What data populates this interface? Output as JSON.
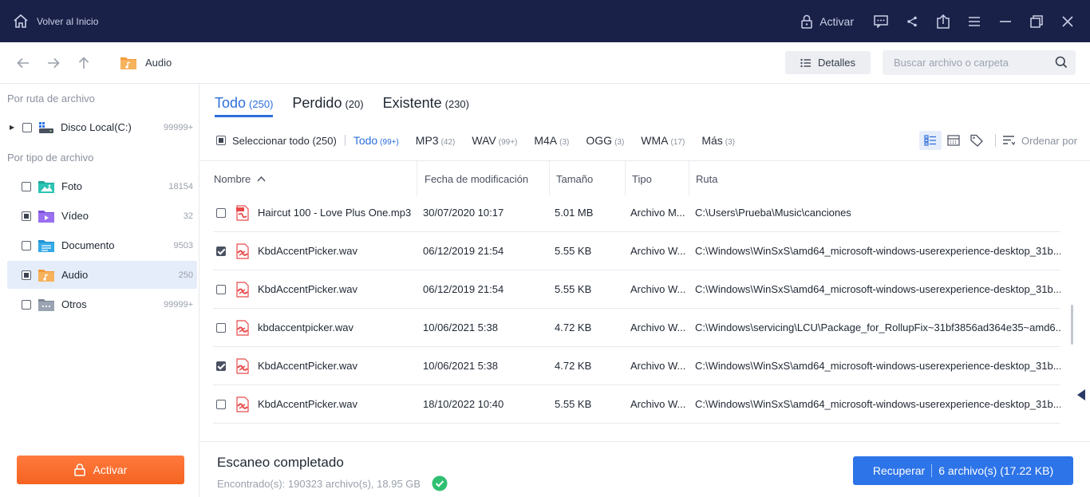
{
  "titlebar": {
    "home_label": "Volver al Inicio",
    "activate_label": "Activar",
    "bg_color": "#1a2148"
  },
  "navbar": {
    "breadcrumb": "Audio",
    "details_label": "Detalles",
    "search_placeholder": "Buscar archivo o carpeta"
  },
  "sidebar": {
    "section_path": "Por ruta de archivo",
    "disk": {
      "label": "Disco Local(C:)",
      "count": "99999+"
    },
    "section_type": "Por tipo de archivo",
    "types": [
      {
        "label": "Foto",
        "count": "18154",
        "icon": "photo-folder-icon",
        "state": "none"
      },
      {
        "label": "Vídeo",
        "count": "32",
        "icon": "video-folder-icon",
        "state": "partial"
      },
      {
        "label": "Documento",
        "count": "9503",
        "icon": "document-folder-icon",
        "state": "none"
      },
      {
        "label": "Audio",
        "count": "250",
        "icon": "audio-folder-icon",
        "state": "partial"
      },
      {
        "label": "Otros",
        "count": "99999+",
        "icon": "other-folder-icon",
        "state": "none"
      }
    ],
    "activate_label": "Activar",
    "accent_color": "#f46321"
  },
  "tabs": [
    {
      "label": "Todo",
      "count": "(250)"
    },
    {
      "label": "Perdido",
      "count": "(20)"
    },
    {
      "label": "Existente",
      "count": "(230)"
    }
  ],
  "filters": {
    "select_all": "Seleccionar todo (250)",
    "types": [
      {
        "label": "Todo",
        "count": "(99+)"
      },
      {
        "label": "MP3",
        "count": "(42)"
      },
      {
        "label": "WAV",
        "count": "(99+)"
      },
      {
        "label": "M4A",
        "count": "(3)"
      },
      {
        "label": "OGG",
        "count": "(3)"
      },
      {
        "label": "WMA",
        "count": "(17)"
      },
      {
        "label": "Más",
        "count": "(3)"
      }
    ],
    "sort_label": "Ordenar por"
  },
  "table": {
    "columns": [
      "Nombre",
      "Fecha de modificación",
      "Tamaño",
      "Tipo",
      "Ruta"
    ],
    "rows": [
      {
        "checked": false,
        "icon": "mp3-file-icon",
        "name": "Haircut 100 - Love Plus One.mp3",
        "date": "30/07/2020 10:17",
        "size": "5.01 MB",
        "type": "Archivo M...",
        "path": "C:\\Users\\Prueba\\Music\\canciones"
      },
      {
        "checked": true,
        "icon": "wav-file-icon",
        "name": "KbdAccentPicker.wav",
        "date": "06/12/2019 21:54",
        "size": "5.55 KB",
        "type": "Archivo W...",
        "path": "C:\\Windows\\WinSxS\\amd64_microsoft-windows-userexperience-desktop_31b..."
      },
      {
        "checked": false,
        "icon": "wav-file-icon",
        "name": "KbdAccentPicker.wav",
        "date": "06/12/2019 21:54",
        "size": "5.55 KB",
        "type": "Archivo W...",
        "path": "C:\\Windows\\WinSxS\\amd64_microsoft-windows-userexperience-desktop_31b..."
      },
      {
        "checked": false,
        "icon": "wav-file-icon",
        "name": "kbdaccentpicker.wav",
        "date": "10/06/2021 5:38",
        "size": "4.72 KB",
        "type": "Archivo W...",
        "path": "C:\\Windows\\servicing\\LCU\\Package_for_RollupFix~31bf3856ad364e35~amd6..."
      },
      {
        "checked": true,
        "icon": "wav-file-icon",
        "name": "KbdAccentPicker.wav",
        "date": "10/06/2021 5:38",
        "size": "4.72 KB",
        "type": "Archivo W...",
        "path": "C:\\Windows\\WinSxS\\amd64_microsoft-windows-userexperience-desktop_31b..."
      },
      {
        "checked": false,
        "icon": "wav-file-icon",
        "name": "KbdAccentPicker.wav",
        "date": "18/10/2022 10:40",
        "size": "5.55 KB",
        "type": "Archivo W...",
        "path": "C:\\Windows\\WinSxS\\amd64_microsoft-windows-userexperience-desktop_31b..."
      }
    ]
  },
  "footer": {
    "title": "Escaneo completado",
    "found": "Encontrado(s): 190323 archivo(s), 18.95 GB",
    "recover_label": "Recuperar",
    "recover_count": "6 archivo(s) (17.22 KB)",
    "primary_color": "#2d74e8"
  }
}
